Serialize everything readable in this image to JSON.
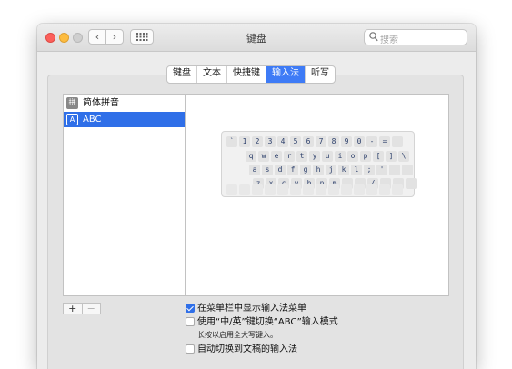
{
  "window": {
    "title": "键盘",
    "nav_back": "‹",
    "nav_forward": "›",
    "search_placeholder": "搜索"
  },
  "tabs": [
    {
      "label": "键盘",
      "active": false
    },
    {
      "label": "文本",
      "active": false
    },
    {
      "label": "快捷键",
      "active": false
    },
    {
      "label": "输入法",
      "active": true
    },
    {
      "label": "听写",
      "active": false
    }
  ],
  "input_sources": [
    {
      "icon_text": "拼",
      "icon": "pinyin-icon",
      "label": "简体拼音",
      "selected": false
    },
    {
      "icon_text": "A",
      "icon": "abc-icon",
      "label": "ABC",
      "selected": true
    }
  ],
  "keyboard_rows": [
    [
      "`",
      "1",
      "2",
      "3",
      "4",
      "5",
      "6",
      "7",
      "8",
      "9",
      "0",
      "-",
      "="
    ],
    [
      "q",
      "w",
      "e",
      "r",
      "t",
      "y",
      "u",
      "i",
      "o",
      "p",
      "[",
      "]",
      "\\"
    ],
    [
      "a",
      "s",
      "d",
      "f",
      "g",
      "h",
      "j",
      "k",
      "l",
      ";",
      "'"
    ],
    [
      "z",
      "x",
      "c",
      "v",
      "b",
      "n",
      "m",
      ",",
      ".",
      "/"
    ]
  ],
  "list_buttons": {
    "add": "+",
    "remove": "−"
  },
  "options": {
    "show_menu": {
      "label": "在菜单栏中显示输入法菜单",
      "checked": true
    },
    "use_caps": {
      "label": "使用“中/英”键切换“ABC”输入模式",
      "checked": false
    },
    "caps_note": "长按以启用全大写键入。",
    "auto_switch": {
      "label": "自动切换到文稿的输入法",
      "checked": false
    }
  },
  "colors": {
    "accent": "#2f6fe8",
    "tab_active": "#3e7bf6"
  }
}
